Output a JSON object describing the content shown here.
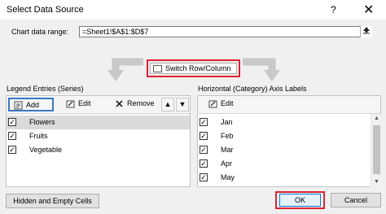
{
  "window": {
    "title": "Select Data Source",
    "help_label": "?",
    "close_label": "✕"
  },
  "chart_range": {
    "label": "Chart data range:",
    "value": "=Sheet1!$A$1:$D$7",
    "collapse_icon": "collapse-dialog-icon"
  },
  "switch": {
    "label": "Switch Row/Column",
    "icon": "switch-row-column-icon"
  },
  "legend": {
    "title": "Legend Entries (Series)",
    "toolbar": {
      "add": "Add",
      "edit": "Edit",
      "remove": "Remove",
      "up": "▲",
      "down": "▼"
    },
    "items": [
      {
        "label": "Flowers",
        "checked": true,
        "selected": true
      },
      {
        "label": "Fruits",
        "checked": true,
        "selected": false
      },
      {
        "label": "Vegetable",
        "checked": true,
        "selected": false
      }
    ]
  },
  "axis": {
    "title": "Horizontal (Category) Axis Labels",
    "toolbar": {
      "edit": "Edit"
    },
    "items": [
      {
        "label": "Jan",
        "checked": true
      },
      {
        "label": "Feb",
        "checked": true
      },
      {
        "label": "Mar",
        "checked": true
      },
      {
        "label": "Apr",
        "checked": true
      },
      {
        "label": "May",
        "checked": true
      }
    ]
  },
  "footer": {
    "hidden_cells": "Hidden and Empty Cells",
    "ok": "OK",
    "cancel": "Cancel"
  },
  "colors": {
    "highlight": "#e0212f",
    "focus": "#3a78c6",
    "ok_border": "#0078d7"
  }
}
